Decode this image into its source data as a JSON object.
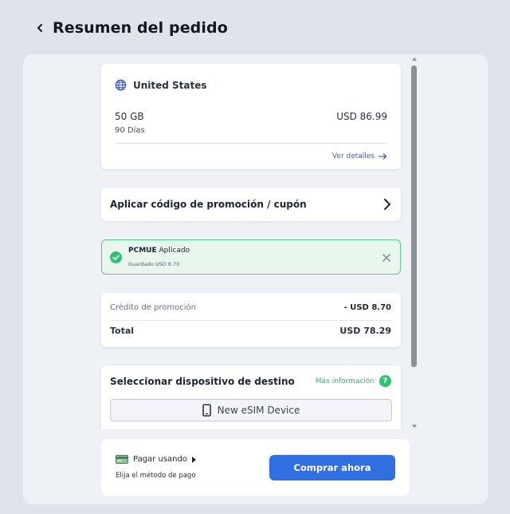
{
  "header": {
    "title": "Resumen del pedido",
    "back_icon": "chevron-left-icon"
  },
  "plan": {
    "country": "United States",
    "data_amount": "50 GB",
    "duration": "90 Días",
    "price": "USD 86.99",
    "details_link": "Ver detalles"
  },
  "promo": {
    "label": "Aplicar código de promoción / cupón"
  },
  "applied": {
    "code": "PCMUE",
    "status": "Aplicado",
    "saved": "Guardado USD 8.70",
    "accent": "#5cc88c"
  },
  "summary": {
    "credit_label": "Crédito de promoción",
    "credit_value": "- USD 8.70",
    "total_label": "Total",
    "total_value": "USD 78.29"
  },
  "device": {
    "title": "Seleccionar dispositivo de destino",
    "more_info": "Más información",
    "selected": "New eSIM Device"
  },
  "payment": {
    "method_label": "Pagar usando",
    "hint": "Elija el método de pago",
    "buy_label": "Comprar ahora",
    "button_color": "#2f6fe0"
  }
}
